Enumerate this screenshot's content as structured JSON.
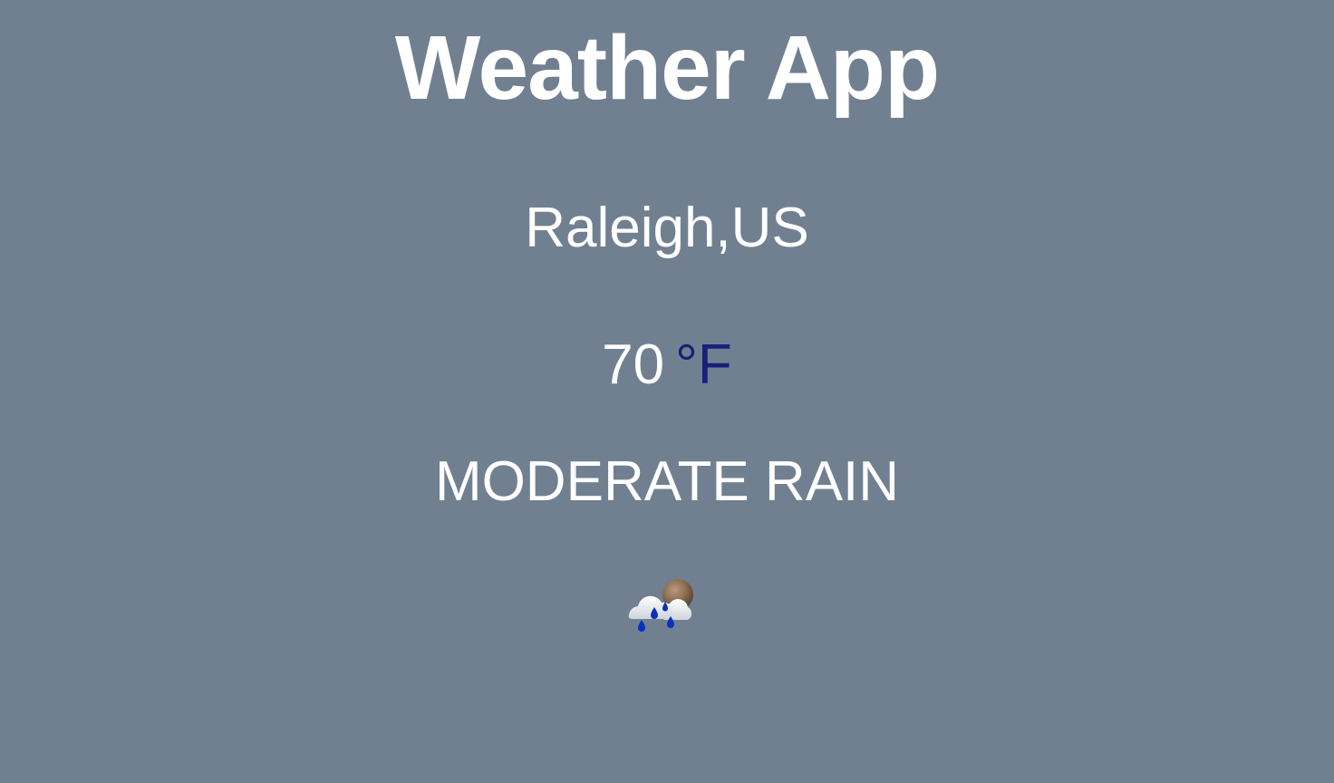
{
  "app": {
    "title": "Weather App"
  },
  "weather": {
    "location": "Raleigh,US",
    "temperature": "70",
    "unit": "°F",
    "condition": "MODERATE RAIN",
    "icon": "rain-moon-icon"
  },
  "colors": {
    "background": "#718090",
    "text": "#ffffff",
    "unit": "#1a1f7a"
  }
}
